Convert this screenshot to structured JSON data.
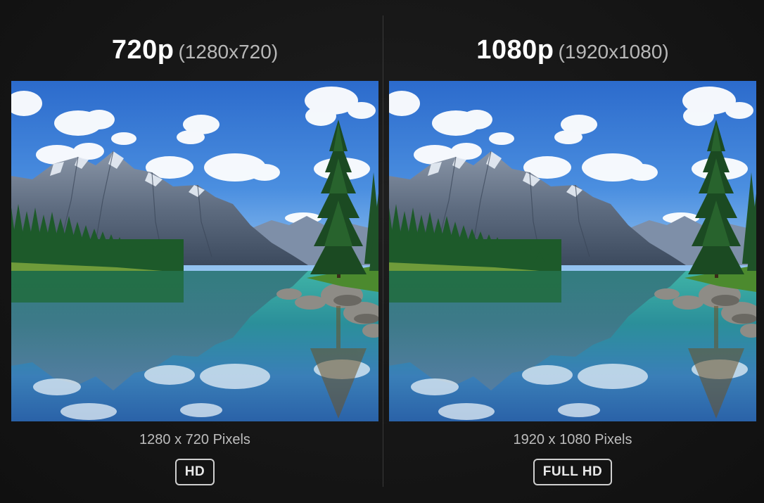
{
  "left": {
    "resolution": "720p",
    "dimensions": "(1280x720)",
    "caption": "1280 x 720 Pixels",
    "badge": "HD"
  },
  "right": {
    "resolution": "1080p",
    "dimensions": "(1920x1080)",
    "caption": "1920 x 1080 Pixels",
    "badge": "FULL HD"
  },
  "colors": {
    "background": "#151515",
    "sky_top": "#2f6fd0",
    "sky_bottom": "#8ec1f0",
    "lake": "#2aa3a8",
    "forest": "#1f5a2a"
  }
}
